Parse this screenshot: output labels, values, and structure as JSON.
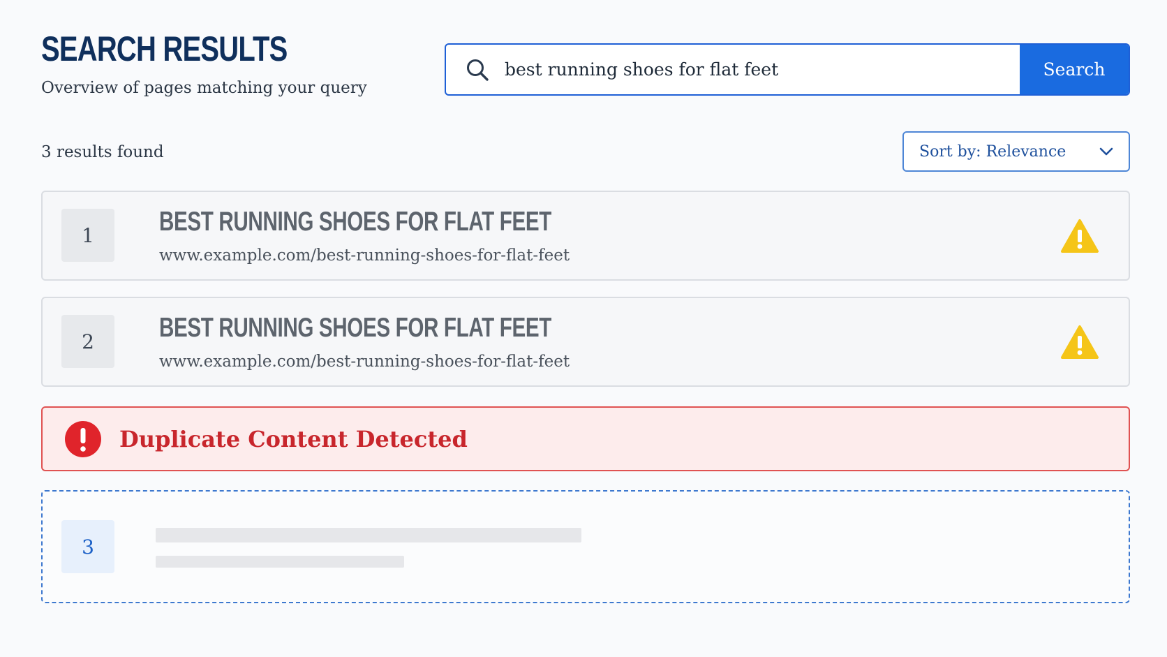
{
  "header": {
    "title": "SEARCH RESULTS",
    "subtitle": "Overview of pages matching your query"
  },
  "search": {
    "query": "best running shoes for flat feet",
    "button_label": "Search",
    "icon": "search-icon"
  },
  "results_meta": {
    "count_text": "3 results found",
    "sort_label": "Sort by: Relevance",
    "sort_icon": "chevron-down-icon"
  },
  "results": [
    {
      "rank": "1",
      "title": "BEST RUNNING SHOES FOR FLAT FEET",
      "url": "www.example.com/best-running-shoes-for-flat-feet",
      "status_icon": "warning-icon"
    },
    {
      "rank": "2",
      "title": "BEST RUNNING SHOES FOR FLAT FEET",
      "url": "www.example.com/best-running-shoes-for-flat-feet",
      "status_icon": "warning-icon"
    }
  ],
  "alert": {
    "icon": "error-icon",
    "message": "Duplicate Content Detected"
  },
  "loading_result": {
    "rank": "3"
  },
  "colors": {
    "accent": "#1a6be0",
    "title": "#0f2f5c",
    "warning": "#f5c518",
    "error": "#e0242b",
    "error_bg": "#fdecec"
  }
}
